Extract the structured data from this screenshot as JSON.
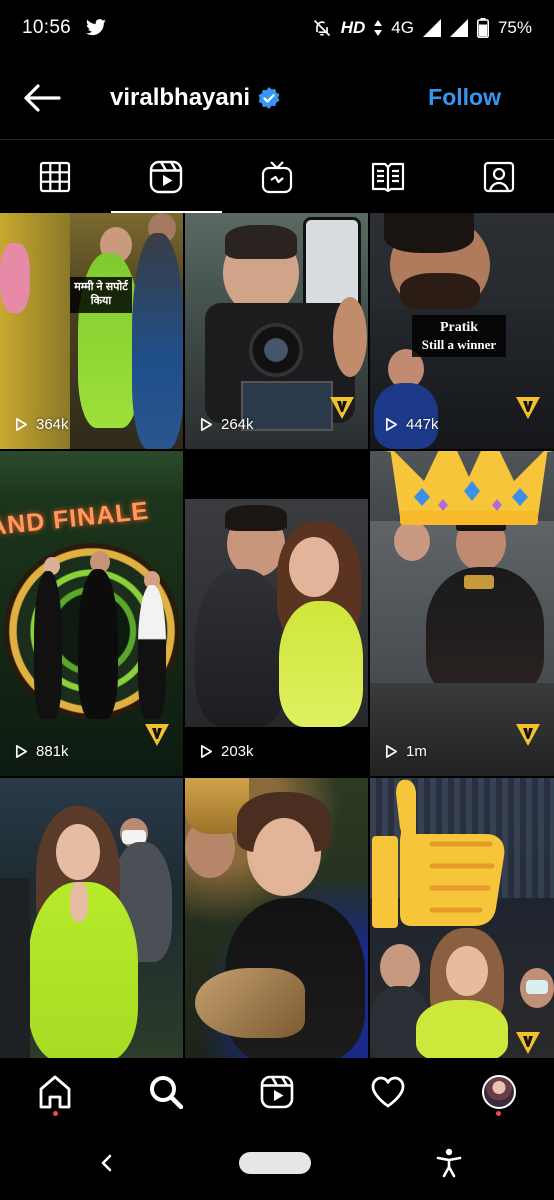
{
  "status_bar": {
    "time": "10:56",
    "network": "HD",
    "network_type": "4G",
    "battery": "75%"
  },
  "header": {
    "username": "viralbhayani",
    "follow_label": "Follow",
    "colors": {
      "follow": "#3797f0",
      "verified": "#3797f0"
    }
  },
  "tabs": [
    {
      "icon": "grid-icon",
      "active": false
    },
    {
      "icon": "reels-icon",
      "active": true
    },
    {
      "icon": "igtv-icon",
      "active": false
    },
    {
      "icon": "guides-icon",
      "active": false
    },
    {
      "icon": "tagged-icon",
      "active": false
    }
  ],
  "reels": [
    {
      "views": "364k",
      "caption": "मम्मी ने सपोर्ट किया"
    },
    {
      "views": "264k"
    },
    {
      "views": "447k",
      "caption_line1": "Pratik",
      "caption_line2": "Still a winner"
    },
    {
      "views": "881k",
      "banner": "AND FINALE"
    },
    {
      "views": "203k"
    },
    {
      "views": "1m"
    },
    {},
    {},
    {}
  ],
  "bottom_nav": [
    {
      "icon": "home-icon"
    },
    {
      "icon": "search-icon"
    },
    {
      "icon": "reels-icon"
    },
    {
      "icon": "heart-icon"
    },
    {
      "icon": "profile-avatar"
    }
  ]
}
